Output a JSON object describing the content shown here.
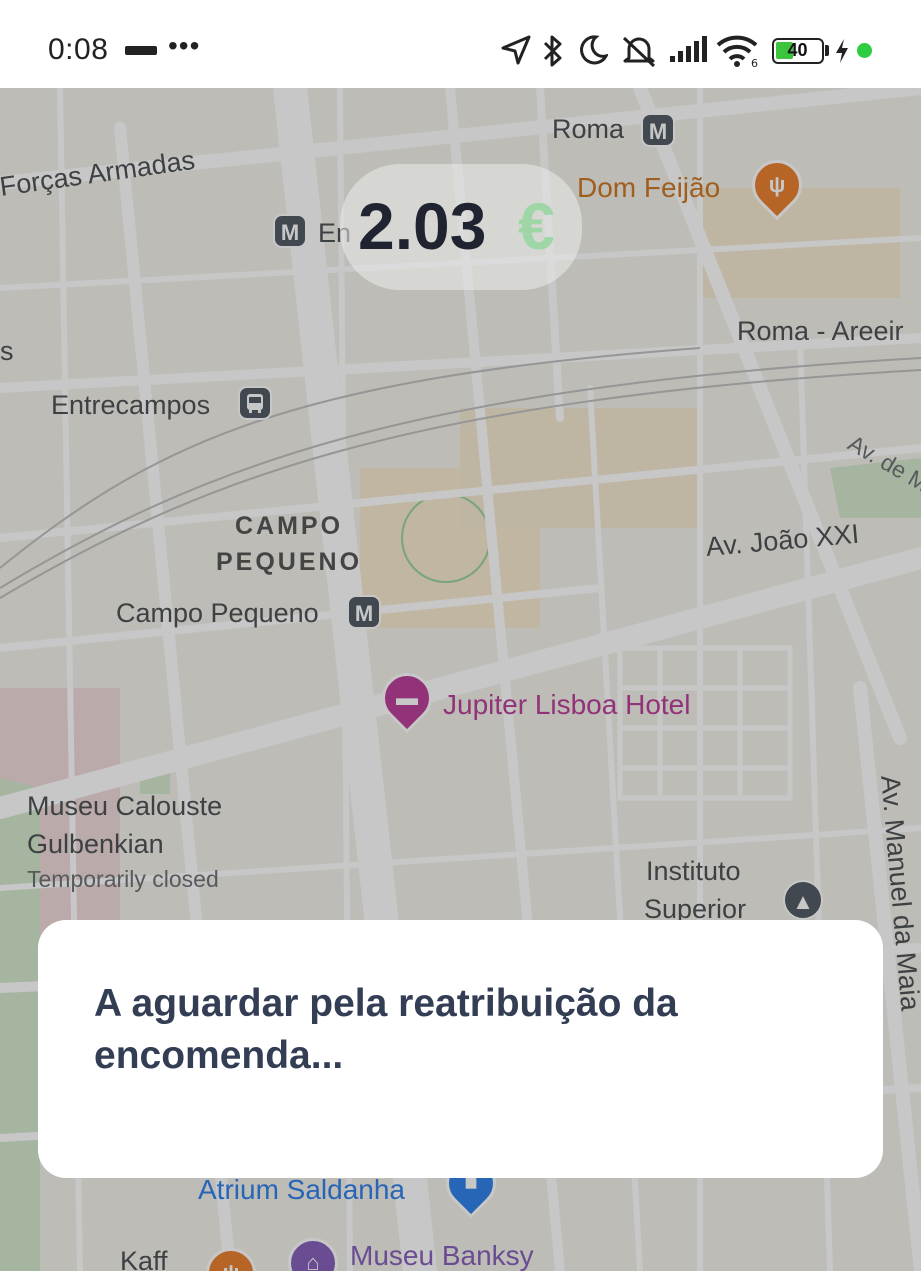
{
  "status_bar": {
    "time": "0:08",
    "battery_level": "40",
    "icons": [
      "location-arrow-icon",
      "bluetooth-icon",
      "moon-icon",
      "mute-icon",
      "signal-icon",
      "wifi-icon",
      "battery-icon",
      "charging-icon"
    ]
  },
  "map": {
    "labels": {
      "roma": "Roma",
      "dom_feijao": "Dom Feijão",
      "forcas_armadas": "Forças Armadas",
      "entrecampos_partial": "En",
      "roma_areeiro": "Roma - Areeir",
      "s_partial": "s",
      "entrecampos": "Entrecampos",
      "av_de": "Av. de M",
      "campo_pequeno_district_line1": "CAMPO",
      "campo_pequeno_district_line2": "PEQUENO",
      "av_joao_xxi": "Av. João XXI",
      "campo_pequeno_station": "Campo Pequeno",
      "jupiter_hotel": "Jupiter Lisboa Hotel",
      "museu_calouste_line1": "Museu Calouste",
      "museu_calouste_line2": "Gulbenkian",
      "temporarily_closed": "Temporarily closed",
      "instituto_line1": "Instituto",
      "instituto_line2": "Superior",
      "av_manuel_da_maia": "Av. Manuel da Maia",
      "atrium_saldanha": "Atrium Saldanha",
      "museu_banksy": "Museu Banksy",
      "kaff_partial": "Kaff"
    },
    "metro_symbol": "M"
  },
  "price": {
    "value": "2.03",
    "currency": "€"
  },
  "dialog": {
    "message": "A aguardar pela reatribuição da encomenda..."
  },
  "colors": {
    "accent_text": "#333e55",
    "price_text": "#1f2430",
    "currency": "#9ed6a6",
    "hotel": "#b42a8f",
    "restaurant": "#c8690f",
    "metro": "#3f4a55"
  }
}
